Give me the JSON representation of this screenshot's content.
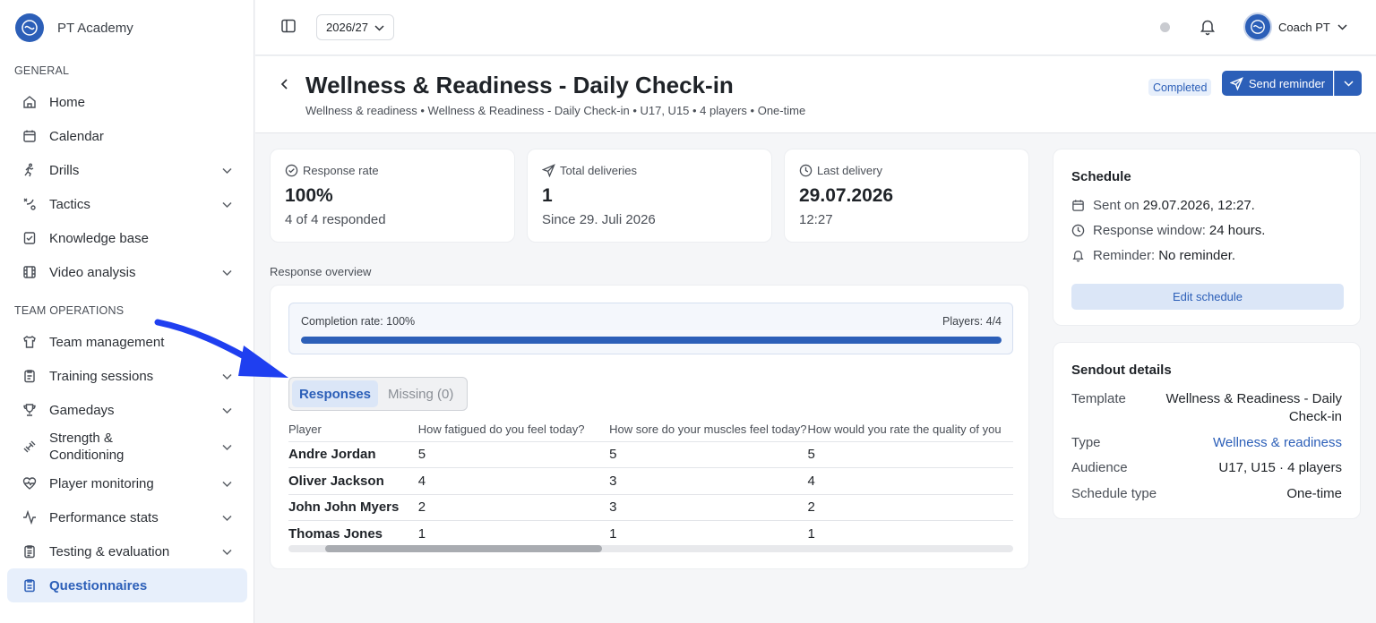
{
  "brand": {
    "name": "PT Academy",
    "logo_icon": "club-logo-icon"
  },
  "sidebar": {
    "general_label": "GENERAL",
    "team_ops_label": "TEAM OPERATIONS",
    "general_items": [
      {
        "label": "Home",
        "icon": "home-icon"
      },
      {
        "label": "Calendar",
        "icon": "calendar-icon"
      },
      {
        "label": "Drills",
        "icon": "runner-icon"
      },
      {
        "label": "Tactics",
        "icon": "tactics-icon"
      },
      {
        "label": "Knowledge base",
        "icon": "book-icon"
      },
      {
        "label": "Video analysis",
        "icon": "film-icon"
      }
    ],
    "team_items": [
      {
        "label": "Team management",
        "icon": "shirt-icon"
      },
      {
        "label": "Training sessions",
        "icon": "clipboard-icon"
      },
      {
        "label": "Gamedays",
        "icon": "trophy-icon"
      },
      {
        "label": "Strength & Conditioning",
        "icon": "dumbbell-icon"
      },
      {
        "label": "Player monitoring",
        "icon": "heart-pulse-icon"
      },
      {
        "label": "Performance stats",
        "icon": "activity-icon"
      },
      {
        "label": "Testing & evaluation",
        "icon": "checklist-icon"
      },
      {
        "label": "Questionnaires",
        "icon": "clipboard-list-icon"
      }
    ],
    "accent_color": "#2c5fb8"
  },
  "topbar": {
    "season": "2026/27",
    "user_name": "Coach PT"
  },
  "header": {
    "title": "Wellness & Readiness - Daily Check-in",
    "breadcrumb": "Wellness & readiness • Wellness & Readiness - Daily Check-in • U17, U15 • 4 players • One-time",
    "status_badge": "Completed",
    "send_label": "Send reminder"
  },
  "stats": [
    {
      "label": "Response rate",
      "icon": "check-circle-icon",
      "value": "100%",
      "sub": "4 of 4 responded"
    },
    {
      "label": "Total deliveries",
      "icon": "send-icon",
      "value": "1",
      "sub": "Since 29. Juli 2026"
    },
    {
      "label": "Last delivery",
      "icon": "clock-icon",
      "value": "29.07.2026",
      "sub": "12:27"
    }
  ],
  "overview": {
    "label": "Response overview",
    "completion_label": "Completion rate: 100%",
    "players_label": "Players: 4/4",
    "completion_fraction": 1.0,
    "tabs": {
      "responses": "Responses",
      "missing": "Missing (0)"
    },
    "columns": [
      "Player",
      "How fatigued do you feel today?",
      "How sore do your muscles feel today?",
      "How would you rate the quality of you"
    ],
    "rows": [
      [
        "Andre Jordan",
        "5",
        "5",
        "5"
      ],
      [
        "Oliver Jackson",
        "4",
        "3",
        "4"
      ],
      [
        "John John Myers",
        "2",
        "3",
        "2"
      ],
      [
        "Thomas Jones",
        "1",
        "1",
        "1"
      ]
    ]
  },
  "schedule": {
    "title": "Schedule",
    "sent_label": "Sent on",
    "sent_value": "29.07.2026, 12:27.",
    "window_label": "Response window:",
    "window_value": "24 hours.",
    "reminder_label": "Reminder:",
    "reminder_value": "No reminder.",
    "edit_label": "Edit schedule"
  },
  "sendout": {
    "title": "Sendout details",
    "template_label": "Template",
    "template_value_1": "Wellness & Readiness - Daily",
    "template_value_2": "Check-in",
    "type_label": "Type",
    "type_value": "Wellness & readiness",
    "audience_label": "Audience",
    "audience_value": "U17, U15 · 4 players",
    "schedule_type_label": "Schedule type",
    "schedule_type_value": "One-time"
  }
}
